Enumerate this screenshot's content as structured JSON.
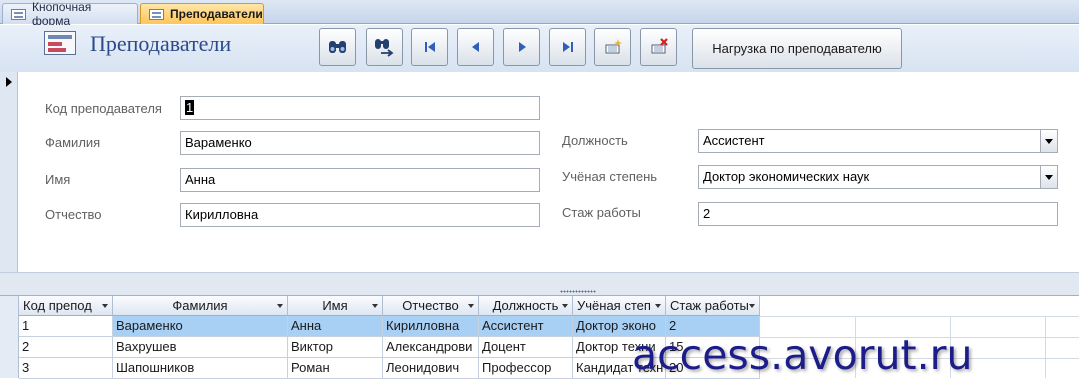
{
  "tabs": [
    {
      "label": "Кнопочная форма",
      "active": false
    },
    {
      "label": "Преподаватели",
      "active": true
    }
  ],
  "header": {
    "title": "Преподаватели",
    "nav_buttons": [
      {
        "name": "find-icon"
      },
      {
        "name": "find-next-icon"
      },
      {
        "name": "first-record-icon"
      },
      {
        "name": "previous-record-icon"
      },
      {
        "name": "next-record-icon"
      },
      {
        "name": "last-record-icon"
      },
      {
        "name": "new-record-icon"
      },
      {
        "name": "delete-record-icon"
      }
    ],
    "load_button": "Нагрузка по преподавателю"
  },
  "form": {
    "id_label": "Код преподавателя",
    "id_value": "1",
    "surname_label": "Фамилия",
    "surname_value": "Вараменко",
    "name_label": "Имя",
    "name_value": "Анна",
    "patronymic_label": "Отчество",
    "patronymic_value": "Кирилловна",
    "position_label": "Должность",
    "position_value": "Ассистент",
    "degree_label": "Учёная степень",
    "degree_value": "Доктор экономических наук",
    "experience_label": "Стаж работы",
    "experience_value": "2"
  },
  "grid": {
    "columns": [
      "Код препод",
      "Фамилия",
      "Имя",
      "Отчество",
      "Должность",
      "Учёная степ",
      "Стаж работы"
    ],
    "rows": [
      [
        "1",
        "Вараменко",
        "Анна",
        "Кирилловна",
        "Ассистент",
        "Доктор эконо",
        "2"
      ],
      [
        "2",
        "Вахрушев",
        "Виктор",
        "Александрови",
        "Доцент",
        "Доктор техни",
        "15"
      ],
      [
        "3",
        "Шапошников",
        "Роман",
        "Леонидович",
        "Профессор",
        "Кандидат техн",
        "20"
      ]
    ]
  },
  "watermark": "access.avorut.ru",
  "colors": {
    "accent_tab": "#ffc55c",
    "title": "#2a4a8a",
    "selected_row": "#a8d0f5",
    "watermark": "#1c1c8a"
  }
}
